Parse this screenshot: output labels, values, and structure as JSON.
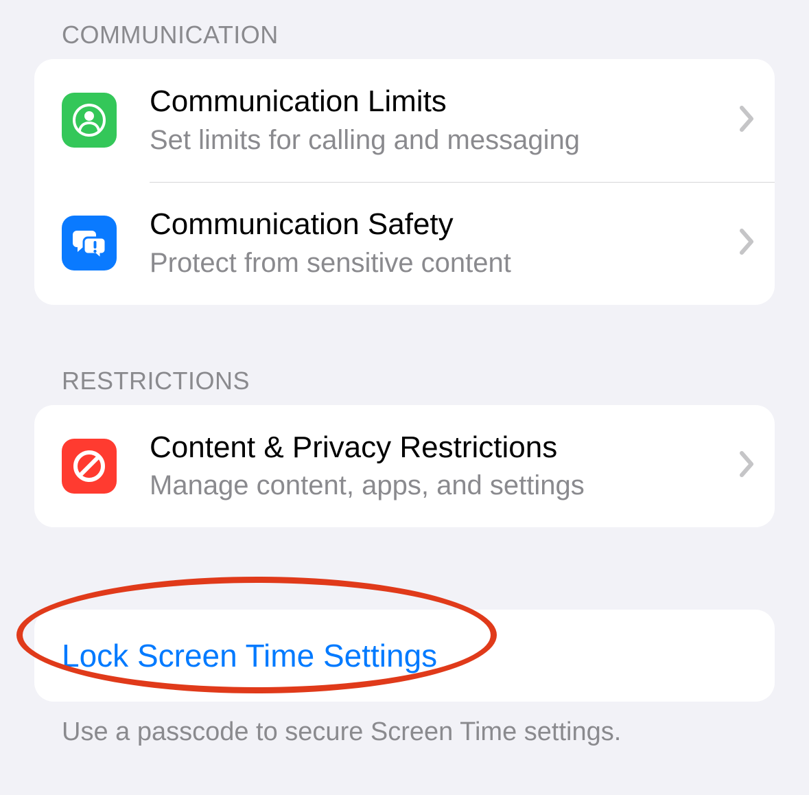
{
  "sections": {
    "communication": {
      "header": "COMMUNICATION",
      "items": [
        {
          "title": "Communication Limits",
          "subtitle": "Set limits for calling and messaging"
        },
        {
          "title": "Communication Safety",
          "subtitle": "Protect from sensitive content"
        }
      ]
    },
    "restrictions": {
      "header": "RESTRICTIONS",
      "items": [
        {
          "title": "Content & Privacy Restrictions",
          "subtitle": "Manage content, apps, and settings"
        }
      ]
    },
    "lock": {
      "label": "Lock Screen Time Settings",
      "footer": "Use a passcode to secure Screen Time settings."
    }
  }
}
